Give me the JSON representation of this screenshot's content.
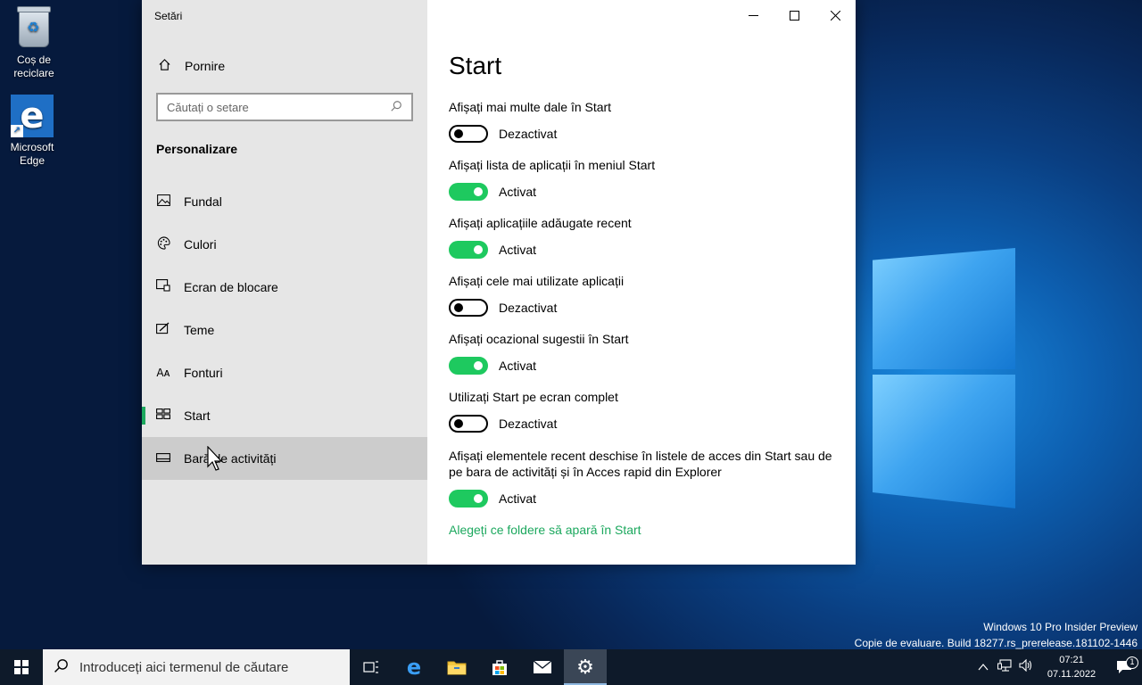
{
  "desktop": {
    "icons": [
      {
        "label": "Coș de reciclare"
      },
      {
        "label": "Microsoft Edge"
      }
    ]
  },
  "window": {
    "title": "Setări",
    "controls": {
      "minimize": "—",
      "maximize": "☐",
      "close": "✕"
    }
  },
  "sidebar": {
    "home_label": "Pornire",
    "search_placeholder": "Căutați o setare",
    "section_title": "Personalizare",
    "items": [
      {
        "label": "Fundal",
        "icon": "picture-icon"
      },
      {
        "label": "Culori",
        "icon": "palette-icon"
      },
      {
        "label": "Ecran de blocare",
        "icon": "lock-screen-icon"
      },
      {
        "label": "Teme",
        "icon": "themes-icon"
      },
      {
        "label": "Fonturi",
        "icon": "fonts-icon"
      },
      {
        "label": "Start",
        "icon": "start-icon"
      },
      {
        "label": "Bară de activități",
        "icon": "taskbar-icon"
      }
    ]
  },
  "content": {
    "title": "Start",
    "settings": [
      {
        "label": "Afișați mai multe dale în Start",
        "on": false,
        "state": "Dezactivat"
      },
      {
        "label": "Afișați lista de aplicații în meniul Start",
        "on": true,
        "state": "Activat"
      },
      {
        "label": "Afișați aplicațiile adăugate recent",
        "on": true,
        "state": "Activat"
      },
      {
        "label": "Afișați cele mai utilizate aplicații",
        "on": false,
        "state": "Dezactivat"
      },
      {
        "label": "Afișați ocazional sugestii în Start",
        "on": true,
        "state": "Activat"
      },
      {
        "label": "Utilizați Start pe ecran complet",
        "on": false,
        "state": "Dezactivat"
      },
      {
        "label": "Afișați elementele recent deschise în listele de acces din Start sau de pe bara de activități și în Acces rapid din Explorer",
        "on": true,
        "state": "Activat"
      }
    ],
    "link": "Alegeți ce foldere să apară în Start"
  },
  "watermark": {
    "line1": "Windows 10 Pro Insider Preview",
    "line2": "Copie de evaluare. Build 18277.rs_prerelease.181102-1446"
  },
  "taskbar": {
    "search_placeholder": "Introduceți aici termenul de căutare",
    "time": "07:21",
    "date": "07.11.2022",
    "notification_count": "1"
  },
  "colors": {
    "accent": "#1ca85e",
    "toggle_on": "#1ec95f",
    "sidebar_bg": "#e6e6e6",
    "taskbar_bg": "#0e1a2a"
  }
}
